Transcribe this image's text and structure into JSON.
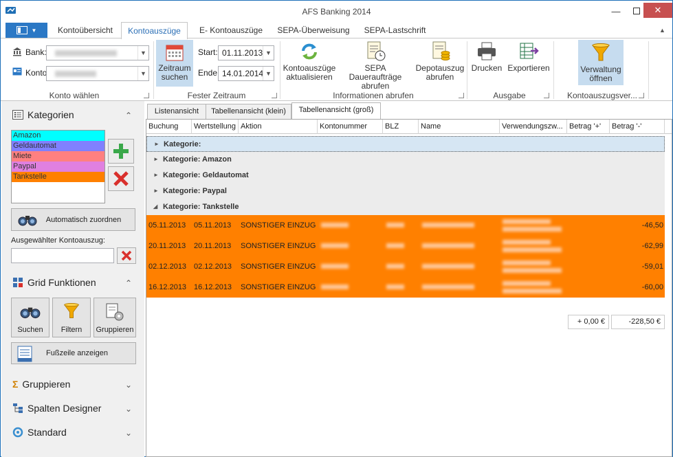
{
  "window": {
    "title": "AFS Banking 2014"
  },
  "ribbon_tabs": [
    "Kontoübersicht",
    "Kontoauszüge",
    "E- Kontoauszüge",
    "SEPA-Überweisung",
    "SEPA-Lastschrift"
  ],
  "active_ribbon_tab": "Kontoauszüge",
  "konto_group": {
    "bank_label": "Bank:",
    "konto_label": "Konto:",
    "group_label": "Konto wählen"
  },
  "zeitraum_group": {
    "button_label_1": "Zeitraum",
    "button_label_2": "suchen",
    "start_label": "Start:",
    "start_value": "01.11.2013",
    "end_label": "Ende:",
    "end_value": "14.01.2014",
    "group_label": "Fester Zeitraum"
  },
  "info_group": {
    "btn1_line1": "Kontoauszüge",
    "btn1_line2": "aktualisieren",
    "btn2_line1": "SEPA Daueraufträge",
    "btn2_line2": "abrufen",
    "btn3_line1": "Depotauszug",
    "btn3_line2": "abrufen",
    "group_label": "Informationen abrufen"
  },
  "ausgabe_group": {
    "print": "Drucken",
    "export": "Exportieren",
    "group_label": "Ausgabe"
  },
  "verwaltung_group": {
    "line1": "Verwaltung",
    "line2": "öffnen",
    "group_label": "Kontoauszugsver..."
  },
  "left_pane": {
    "kategorien_title": "Kategorien",
    "categories": [
      {
        "name": "Amazon",
        "color": "#00ffff"
      },
      {
        "name": "Geldautomat",
        "color": "#8080ff"
      },
      {
        "name": "Miete",
        "color": "#ff8080"
      },
      {
        "name": "Paypal",
        "color": "#e080e0"
      },
      {
        "name": "Tankstelle",
        "color": "#ff8000"
      }
    ],
    "auto_assign": "Automatisch zuordnen",
    "selected_label": "Ausgewählter Kontoauszug:",
    "grid_title": "Grid Funktionen",
    "search": "Suchen",
    "filter": "Filtern",
    "group": "Gruppieren",
    "footer_btn": "Fußzeile anzeigen",
    "section_gruppieren": "Gruppieren",
    "section_spalten": "Spalten Designer",
    "section_standard": "Standard"
  },
  "view_tabs": [
    "Listenansicht",
    "Tabellenansicht (klein)",
    "Tabellenansicht (groß)"
  ],
  "active_view_tab": "Tabellenansicht (groß)",
  "columns": [
    "Buchung",
    "Wertstellung",
    "Aktion",
    "Kontonummer",
    "BLZ",
    "Name",
    "Verwendungszw...",
    "Betrag '+'",
    "Betrag '-'"
  ],
  "groups": [
    "Kategorie:",
    "Kategorie: Amazon",
    "Kategorie: Geldautomat",
    "Kategorie: Paypal",
    "Kategorie: Tankstelle"
  ],
  "rows": [
    {
      "buchung": "05.11.2013",
      "wert": "05.11.2013",
      "aktion": "SONSTIGER EINZUG",
      "betrag_minus": "-46,50"
    },
    {
      "buchung": "20.11.2013",
      "wert": "20.11.2013",
      "aktion": "SONSTIGER EINZUG",
      "betrag_minus": "-62,99"
    },
    {
      "buchung": "02.12.2013",
      "wert": "02.12.2013",
      "aktion": "SONSTIGER EINZUG",
      "betrag_minus": "-59,01"
    },
    {
      "buchung": "16.12.2013",
      "wert": "16.12.2013",
      "aktion": "SONSTIGER EINZUG",
      "betrag_minus": "-60,00"
    }
  ],
  "totals": {
    "plus": "+ 0,00 €",
    "minus": "-228,50 €"
  }
}
